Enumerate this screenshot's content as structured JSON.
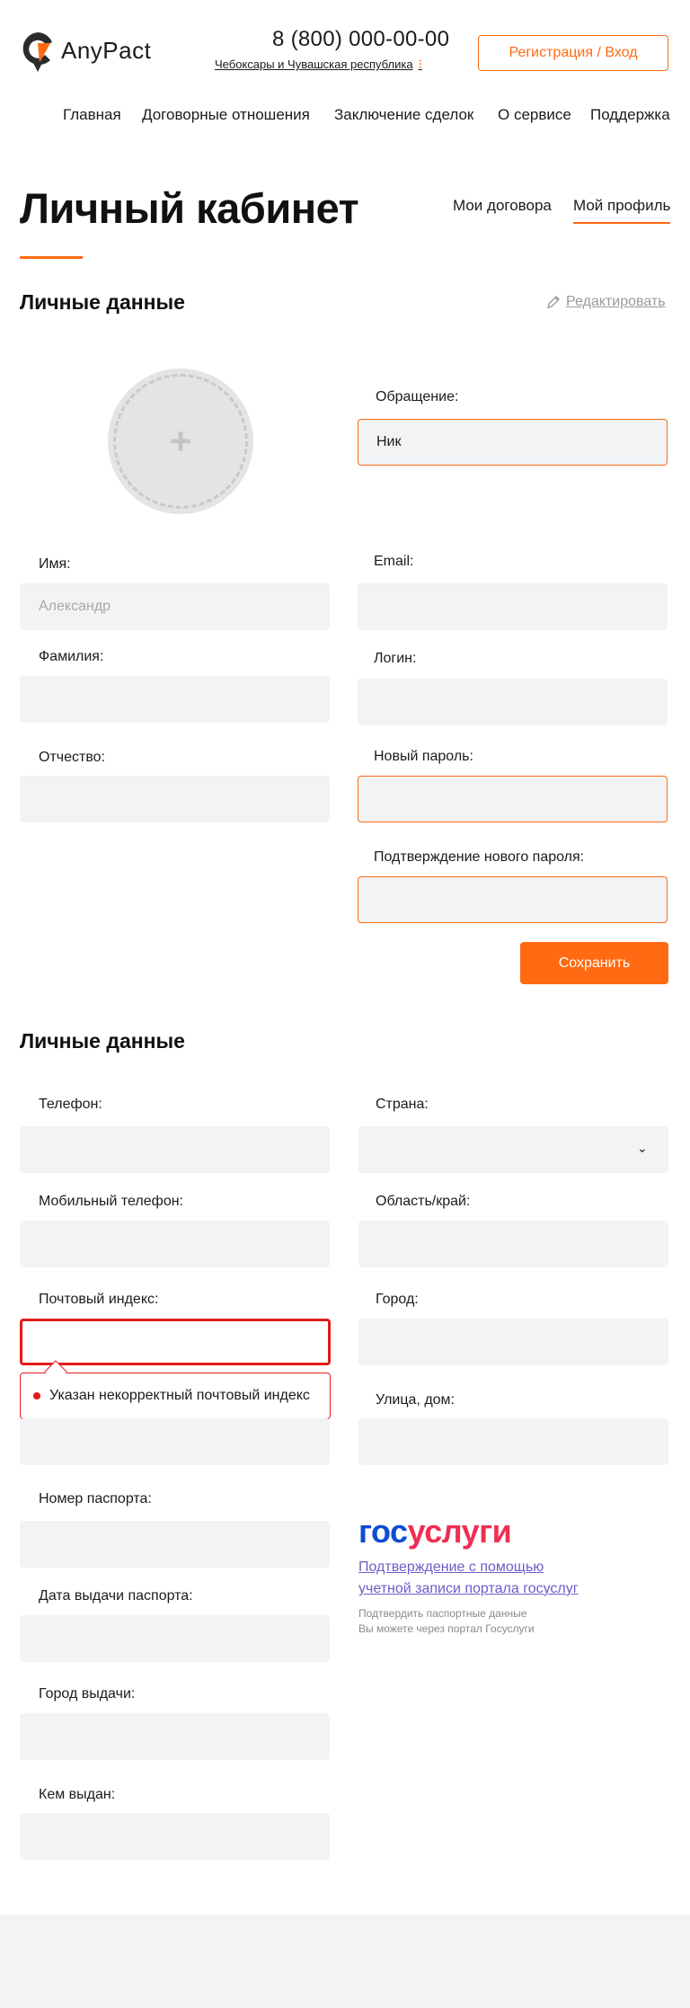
{
  "header": {
    "logo_text": "AnyPact",
    "phone": "8 (800) 000-00-00",
    "region": "Чебоксары и Чувашская республика",
    "auth_button": "Регистрация / Вход",
    "nav": [
      "Главная",
      "Договорные отношения",
      "Заключение сделок",
      "О сервисе",
      "Поддержка"
    ]
  },
  "page": {
    "title": "Личный кабинет",
    "tabs": [
      {
        "label": "Мои договора",
        "active": false
      },
      {
        "label": "Мой профиль",
        "active": true
      }
    ]
  },
  "personal": {
    "section_title": "Личные данные",
    "edit_label": "Редактировать",
    "salutation_label": "Обращение:",
    "salutation_value": "Ник",
    "first_name_label": "Имя:",
    "first_name_placeholder": "Александр",
    "last_name_label": "Фамилия:",
    "middle_name_label": "Отчество:",
    "email_label": "Email:",
    "login_label": "Логин:",
    "new_password_label": "Новый пароль:",
    "confirm_password_label": "Подтверждение нового пароля:",
    "save_button": "Сохранить"
  },
  "contacts": {
    "section_title": "Личные данные",
    "phone_label": "Телефон:",
    "mobile_label": "Мобильный телефон:",
    "postal_label": "Почтовый индекс:",
    "postal_error": "Указан некорректный почтовый индекс",
    "passport_number_label": "Номер паспорта:",
    "passport_date_label": "Дата выдачи паспорта:",
    "issue_city_label": "Город выдачи:",
    "issued_by_label": "Кем выдан:",
    "country_label": "Страна:",
    "region_label": "Область/край:",
    "city_label": "Город:",
    "street_label": "Улица, дом:"
  },
  "gosuslugi": {
    "logo_part1": "гос",
    "logo_part2": "услуги",
    "link": "Подтверждение с помощью учетной записи портала госуслуг",
    "note_line1": "Подтвердить паспортные данные",
    "note_line2": "Вы можете через портал Госуслуги"
  },
  "colors": {
    "accent": "#ff6a13",
    "error": "#e21a1a",
    "field_bg": "#f2f3f5",
    "gos_blue": "#0d4cd3",
    "gos_red": "#ee2f53"
  }
}
